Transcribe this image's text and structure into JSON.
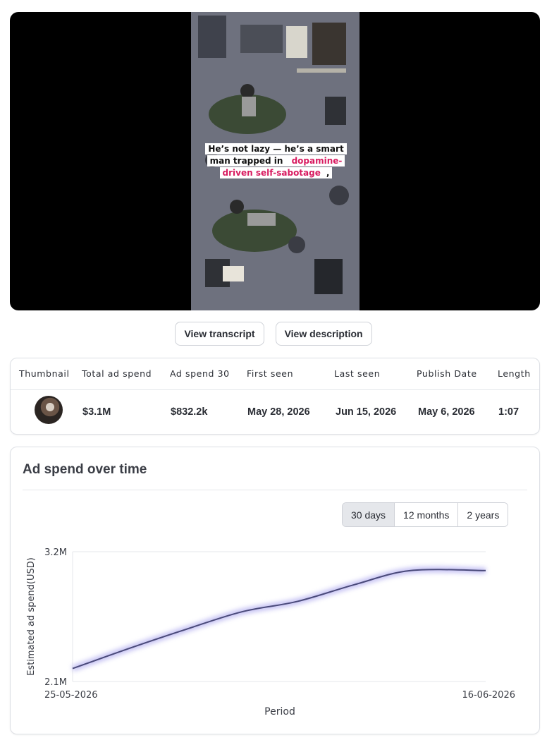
{
  "video": {
    "caption_prefix": "He’s not lazy — he’s a smart man trapped in ",
    "caption_highlight": "dopamine-driven self-sabotage",
    "caption_suffix": ","
  },
  "buttons": {
    "transcript": "View transcript",
    "description": "View description"
  },
  "table": {
    "headers": [
      "Thumbnail",
      "Total ad spend",
      "Ad spend 30",
      "First seen",
      "Last seen",
      "Publish Date",
      "Length"
    ],
    "row": {
      "total_ad_spend": "$3.1M",
      "ad_spend_30": "$832.2k",
      "first_seen": "May 28, 2026",
      "last_seen": "Jun 15, 2026",
      "publish_date": "May 6, 2026",
      "length": "1:07"
    }
  },
  "chart_section": {
    "title": "Ad spend over time",
    "ranges": [
      "30 days",
      "12 months",
      "2 years"
    ],
    "active_range": "30 days"
  },
  "colors": {
    "line": "#4a4a7a",
    "glow": "#8f88e8",
    "caption_highlight": "#d81b60"
  },
  "chart_data": {
    "type": "line",
    "xlabel": "Period",
    "ylabel": "Estimated ad spend(USD)",
    "x_tick_labels": [
      "25-05-2026",
      "16-06-2026"
    ],
    "y_tick_labels": [
      "2.1M",
      "3.2M"
    ],
    "ylim": [
      2.1,
      3.2
    ],
    "y_unit": "M USD",
    "grid": false,
    "legend": "none",
    "series": [
      {
        "x": [
          "2026-05-25",
          "2026-05-28",
          "2026-05-31",
          "2026-06-03",
          "2026-06-06",
          "2026-06-09",
          "2026-06-12",
          "2026-06-16"
        ],
        "values": [
          2.21,
          2.38,
          2.54,
          2.69,
          2.78,
          2.92,
          3.04,
          3.04
        ]
      }
    ]
  }
}
